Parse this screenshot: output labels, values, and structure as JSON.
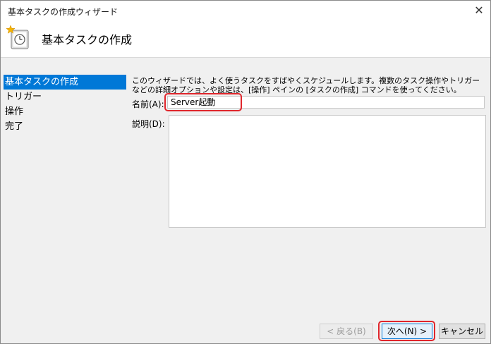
{
  "window": {
    "title": "基本タスクの作成ウィザード"
  },
  "header": {
    "title": "基本タスクの作成"
  },
  "steps": [
    {
      "label": "基本タスクの作成"
    },
    {
      "label": "トリガー"
    },
    {
      "label": "操作"
    },
    {
      "label": "完了"
    }
  ],
  "main": {
    "description": "このウィザードでは、よく使うタスクをすばやくスケジュールします。複数のタスク操作やトリガーなどの詳細オプションや設定は、[操作] ペインの [タスクの作成] コマンドを使ってください。",
    "name_label": "名前(A):",
    "name_value": "Server起動",
    "description_label": "説明(D):",
    "description_value": ""
  },
  "buttons": {
    "back": "< 戻る(B)",
    "next": "次へ(N) >",
    "cancel": "キャンセル"
  }
}
